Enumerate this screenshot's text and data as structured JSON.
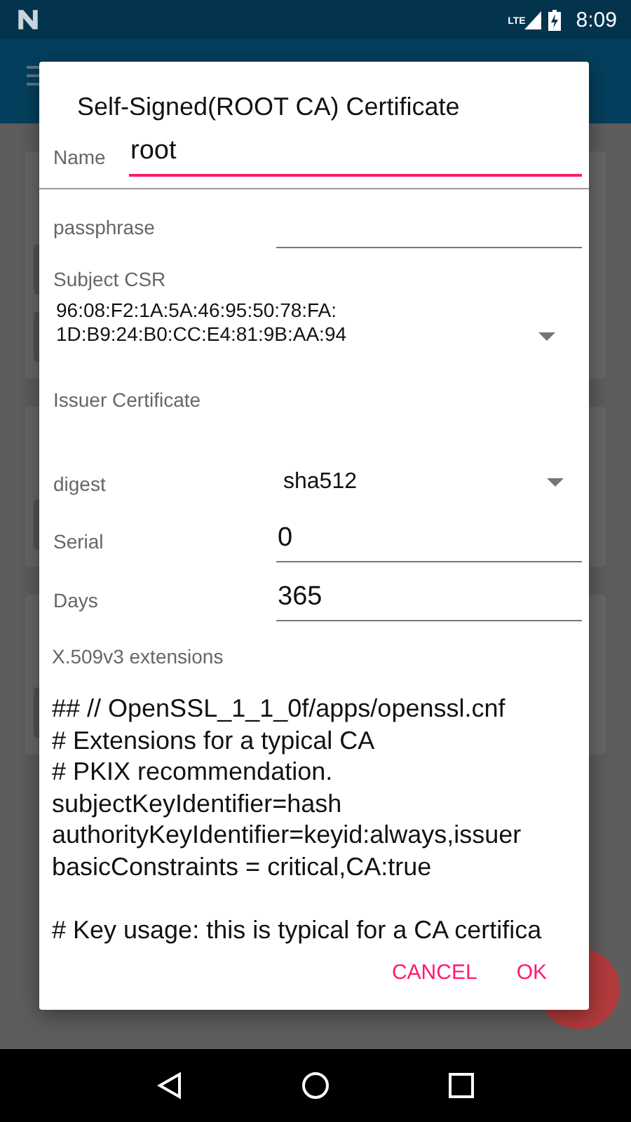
{
  "status_bar": {
    "network_label": "LTE",
    "time": "8:09"
  },
  "dialog": {
    "title": "Self-Signed(ROOT CA) Certificate",
    "fields": [
      {
        "kind": "inline_input",
        "label": "Name",
        "value": "root",
        "focused": true
      },
      {
        "kind": "input",
        "label": "passphrase",
        "focused": false
      },
      {
        "kind": "select_multiline",
        "label": "Subject CSR",
        "lines": [
          "96:08:F2:1A:5A:46:95:50:78:FA:",
          "1D:B9:24:B0:CC:E4:81:9B:AA:94"
        ]
      },
      {
        "kind": "label",
        "label": "Issuer Certificate"
      },
      {
        "kind": "select",
        "label": "digest",
        "value": "sha512"
      },
      {
        "kind": "input",
        "label": "Serial",
        "value": "0",
        "focused": false
      },
      {
        "kind": "input",
        "label": "Days",
        "value": "365",
        "focused": false
      },
      {
        "kind": "textarea",
        "label": "X.509v3 extensions",
        "paragraphs": [
          [
            "## // OpenSSL_1_1_0f/apps/openssl.cnf",
            "# Extensions for a typical CA",
            "# PKIX recommendation.",
            "subjectKeyIdentifier=hash",
            "authorityKeyIdentifier=keyid:always,issuer",
            "basicConstraints = critical,CA:true"
          ],
          [
            "# Key usage: this is typical for a CA certifica"
          ]
        ]
      }
    ],
    "buttons": [
      "CANCEL",
      "OK"
    ]
  }
}
